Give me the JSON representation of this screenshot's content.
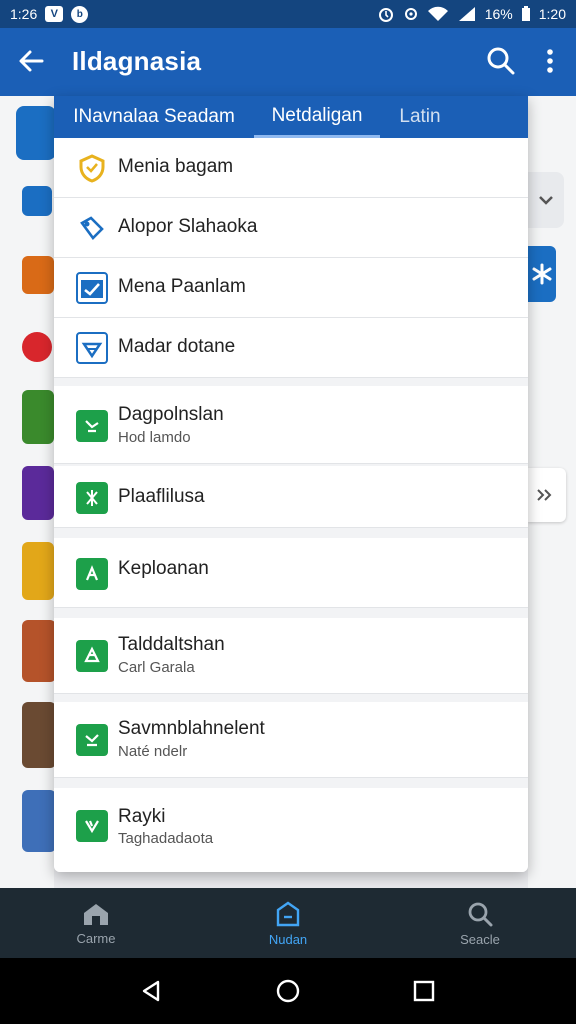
{
  "status_bar": {
    "time_left": "1:26",
    "battery": "16%",
    "time_right": "1:20"
  },
  "app_bar": {
    "title": "Ildagnasia",
    "back_icon": "arrow-back-icon",
    "search_icon": "search-icon",
    "more_icon": "more-vert-icon"
  },
  "tabs": [
    {
      "label": "INavnalaa Seadam"
    },
    {
      "label": "Netdaligan"
    },
    {
      "label": "Latin"
    }
  ],
  "menu_items": [
    {
      "label": "Menia bagam",
      "icon": "shield-icon"
    },
    {
      "label": "Alopor Slahaoka",
      "icon": "puzzle-icon"
    },
    {
      "label": "Mena Paanlam",
      "icon": "chart-icon"
    },
    {
      "label": "Madar dotane",
      "icon": "download-box-icon"
    }
  ],
  "list_items": [
    {
      "label": "Dagpolnslan",
      "sub": "Hod lamdo"
    },
    {
      "label": "Plaaflilusa",
      "sub": ""
    },
    {
      "label": "Keploanan",
      "sub": ""
    },
    {
      "label": "Talddaltshan",
      "sub": "Carl Garala"
    },
    {
      "label": "Savmnblahnelent",
      "sub": "Naté ndelr"
    },
    {
      "label": "Rayki",
      "sub": "Taghadadaota"
    }
  ],
  "bottom_nav": [
    {
      "label": "Carme",
      "icon": "home-icon"
    },
    {
      "label": "Nudan",
      "icon": "inbox-icon"
    },
    {
      "label": "Seacle",
      "icon": "search-icon"
    }
  ],
  "colors": {
    "primary": "#1b5fb6",
    "status_bar": "#14457f",
    "green_icon": "#1da04a",
    "nav_active": "#42a5f5",
    "nav_bg": "#1e2a33"
  }
}
